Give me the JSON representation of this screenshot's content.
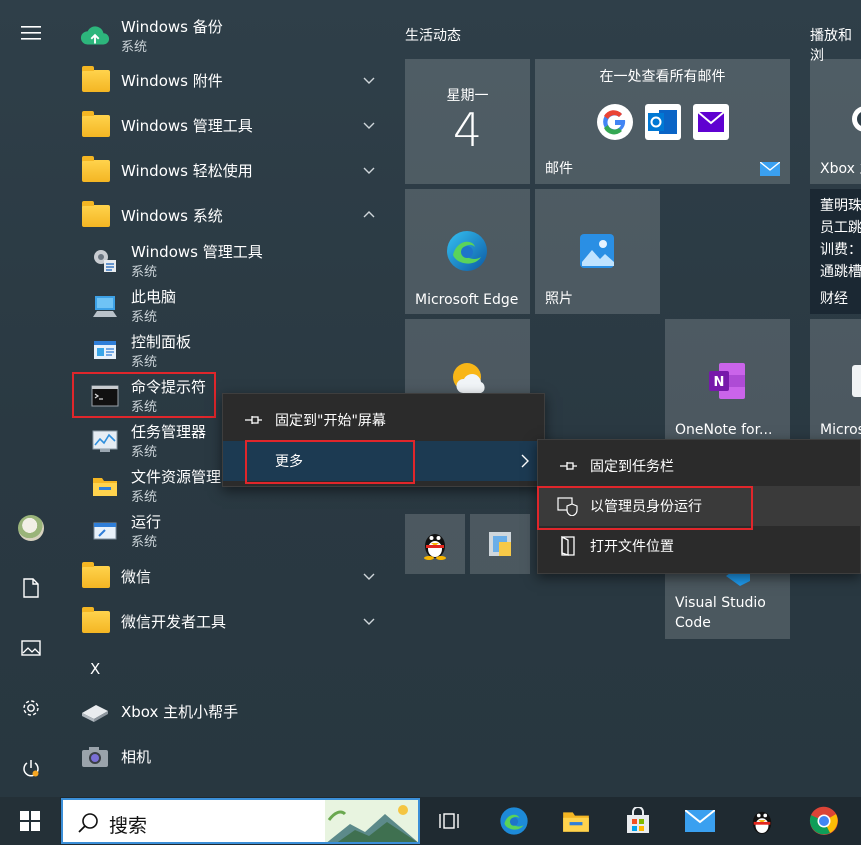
{
  "app_list": {
    "top_app": {
      "name": "Windows 备份",
      "sub": "系统"
    },
    "folders_top": [
      {
        "label": "Windows 附件"
      },
      {
        "label": "Windows 管理工具"
      },
      {
        "label": "Windows 轻松使用"
      },
      {
        "label": "Windows 系统"
      }
    ],
    "system_apps": [
      {
        "name": "Windows 管理工具",
        "sub": "系统"
      },
      {
        "name": "此电脑",
        "sub": "系统"
      },
      {
        "name": "控制面板",
        "sub": "系统"
      },
      {
        "name": "命令提示符",
        "sub": "系统"
      },
      {
        "name": "任务管理器",
        "sub": "系统"
      },
      {
        "name": "文件资源管理",
        "sub": "系统"
      },
      {
        "name": "运行",
        "sub": "系统"
      }
    ],
    "folders_bottom": [
      {
        "label": "微信"
      },
      {
        "label": "微信开发者工具"
      }
    ],
    "letter_x": "X",
    "xbox_helper": "Xbox 主机小帮手",
    "camera": "相机"
  },
  "tiles": {
    "section_life": "生活动态",
    "section_play": "播放和浏",
    "calendar": {
      "day": "星期一",
      "date": "4"
    },
    "mail": {
      "title": "在一处查看所有邮件",
      "label": "邮件"
    },
    "edge": "Microsoft Edge",
    "photos": "照片",
    "xbox": "Xbox 主",
    "onenote": "OneNote for...",
    "micros": "Micros",
    "vscode": [
      "Visual Studio",
      "Code"
    ],
    "news": {
      "lines": [
        "董明珠",
        "员工跳",
        "训费：",
        "通跳槽"
      ],
      "label": "财经"
    }
  },
  "context_menu": {
    "items": [
      {
        "label": "固定到\"开始\"屏幕",
        "icon": "pin-icon"
      },
      {
        "label": "更多",
        "icon": ""
      }
    ]
  },
  "submenu": {
    "items": [
      {
        "label": "固定到任务栏",
        "icon": "pin-icon"
      },
      {
        "label": "以管理员身份运行",
        "icon": "shield-icon"
      },
      {
        "label": "打开文件位置",
        "icon": "folder-open-icon"
      }
    ]
  },
  "taskbar": {
    "search_placeholder": "搜索"
  },
  "colors": {
    "highlight_red": "#e0262b",
    "menu_bg": "#2b2b2b",
    "active_item": "#1c3a52",
    "folder_yellow": "#f4b623",
    "search_border": "#3b8fd8"
  }
}
